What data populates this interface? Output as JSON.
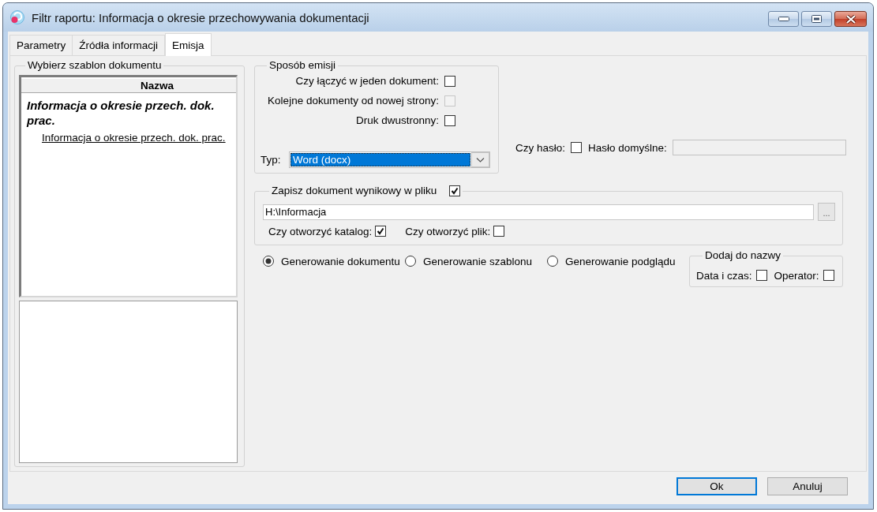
{
  "window": {
    "title": "Filtr raportu: Informacja o okresie przechowywania dokumentacji"
  },
  "tabs": [
    {
      "label": "Parametry",
      "selected": false
    },
    {
      "label": "Źródła informacji",
      "selected": false
    },
    {
      "label": "Emisja",
      "selected": true
    }
  ],
  "template_group": {
    "title": "Wybierz szablon dokumentu",
    "column": "Nazwa",
    "items": [
      {
        "label": "Informacja o okresie przech. dok. prac.",
        "children": [
          {
            "label": "Informacja o okresie przech. dok. prac."
          }
        ]
      }
    ]
  },
  "emission": {
    "title": "Sposób emisji",
    "options": [
      {
        "label": "Czy łączyć w jeden dokument:",
        "checked": false,
        "disabled": false
      },
      {
        "label": "Kolejne dokumenty od nowej strony:",
        "checked": false,
        "disabled": true
      },
      {
        "label": "Druk dwustronny:",
        "checked": false,
        "disabled": false
      }
    ],
    "type": {
      "label": "Typ:",
      "value": "Word (docx)",
      "focused": true
    }
  },
  "password": {
    "label": "Czy hasło:",
    "checked": false,
    "default_label": "Hasło domyślne:",
    "field_disabled": true
  },
  "save": {
    "label": "Zapisz dokument wynikowy w pliku",
    "checked": true,
    "path": "H:\\Informacja",
    "browse": "...",
    "open_folder": {
      "label": "Czy otworzyć katalog:",
      "checked": true
    },
    "open_file": {
      "label": "Czy otworzyć plik:",
      "checked": false
    }
  },
  "generation": [
    {
      "label": "Generowanie dokumentu",
      "selected": true
    },
    {
      "label": "Generowanie szablonu",
      "selected": false
    },
    {
      "label": "Generowanie podglądu",
      "selected": false
    }
  ],
  "name_group": {
    "title": "Dodaj do nazwy",
    "options": [
      {
        "label": "Data i czas:",
        "checked": false
      },
      {
        "label": "Operator:",
        "checked": false
      }
    ]
  },
  "buttons": [
    {
      "label": "Ok",
      "default": true
    },
    {
      "label": "Anuluj",
      "default": false
    }
  ]
}
